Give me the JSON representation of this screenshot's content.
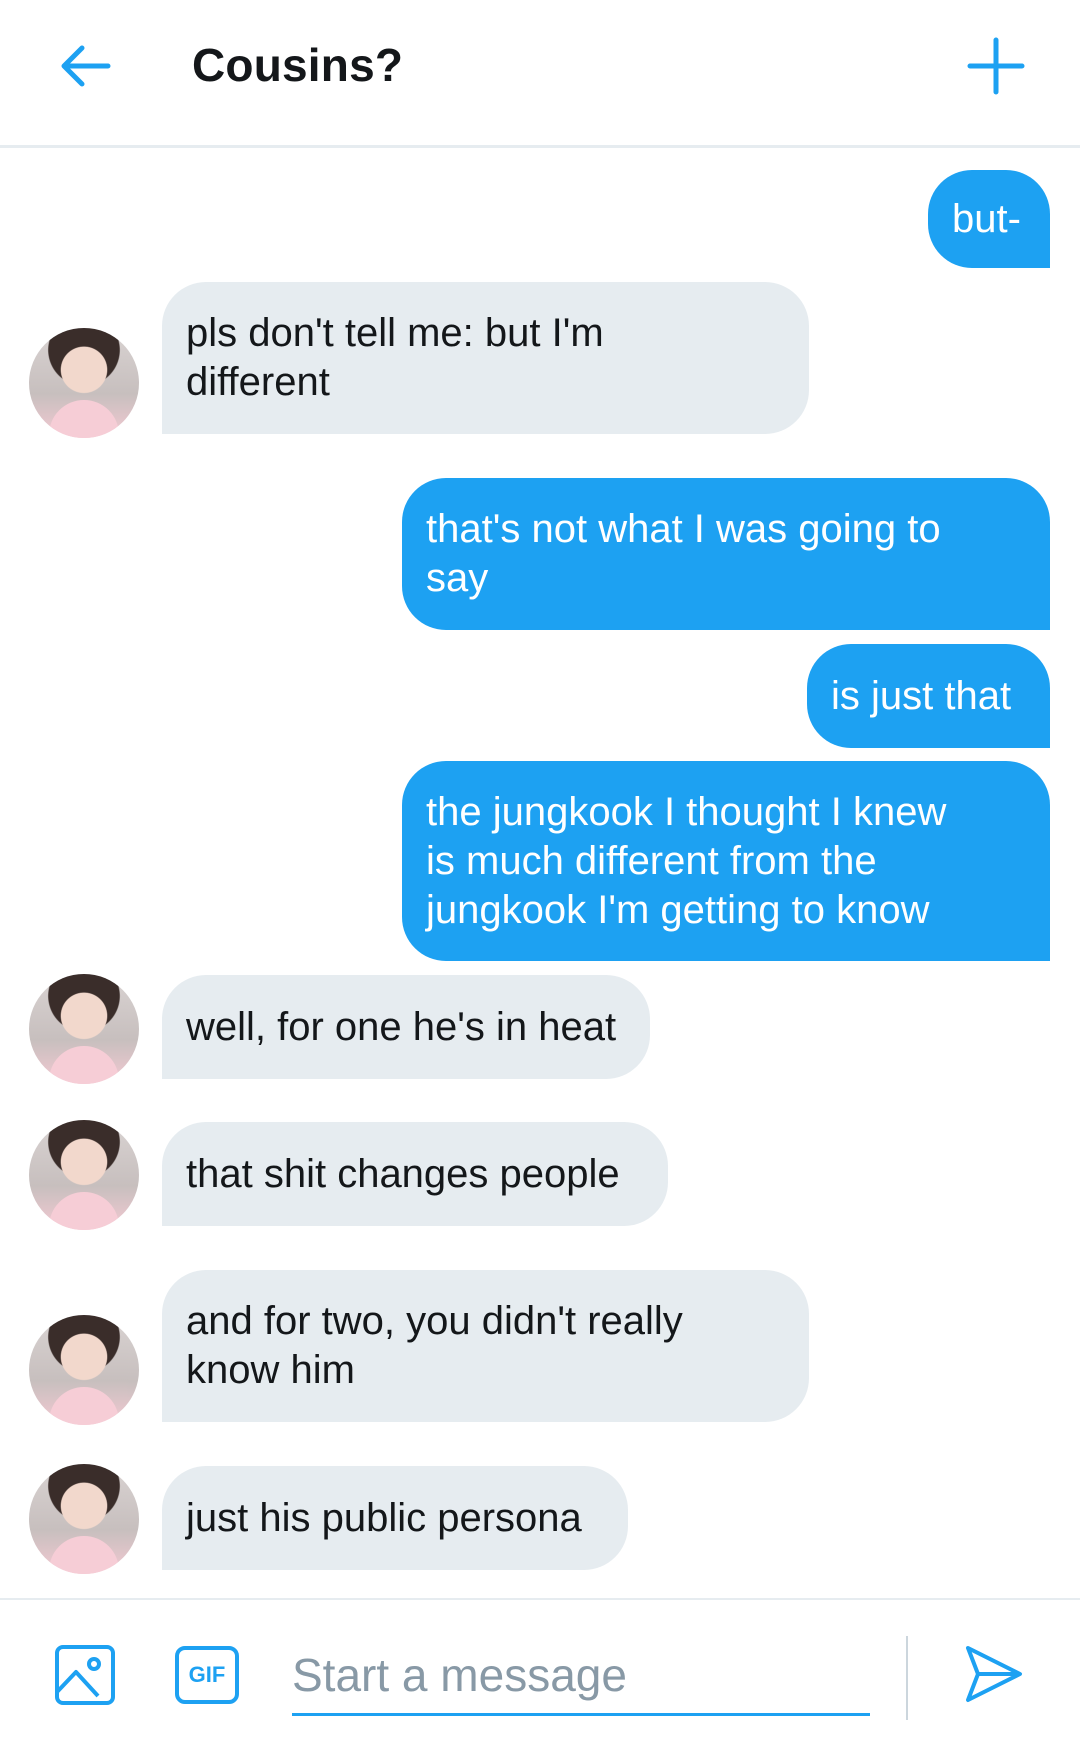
{
  "header": {
    "title": "Cousins?",
    "back_icon": "arrow-left-icon",
    "add_icon": "plus-icon"
  },
  "accent_color": "#1da1f2",
  "messages": [
    {
      "direction": "out",
      "text": "but-"
    },
    {
      "direction": "in",
      "text": "pls don't tell me: but I'm\ndifferent"
    },
    {
      "direction": "out",
      "text": "that's not what I was going to\nsay"
    },
    {
      "direction": "out",
      "text": "is just that"
    },
    {
      "direction": "out",
      "text": "the jungkook I thought I knew\nis much different from the\njungkook I'm getting to know"
    },
    {
      "direction": "in",
      "text": "well, for one he's in heat"
    },
    {
      "direction": "in",
      "text": "that shit changes people"
    },
    {
      "direction": "in",
      "text": "and for two, you didn't really\nknow him"
    },
    {
      "direction": "in",
      "text": "just his public persona"
    }
  ],
  "composer": {
    "placeholder": "Start a message",
    "gif_label": "GIF",
    "media_icon": "image-icon",
    "send_icon": "send-icon"
  }
}
